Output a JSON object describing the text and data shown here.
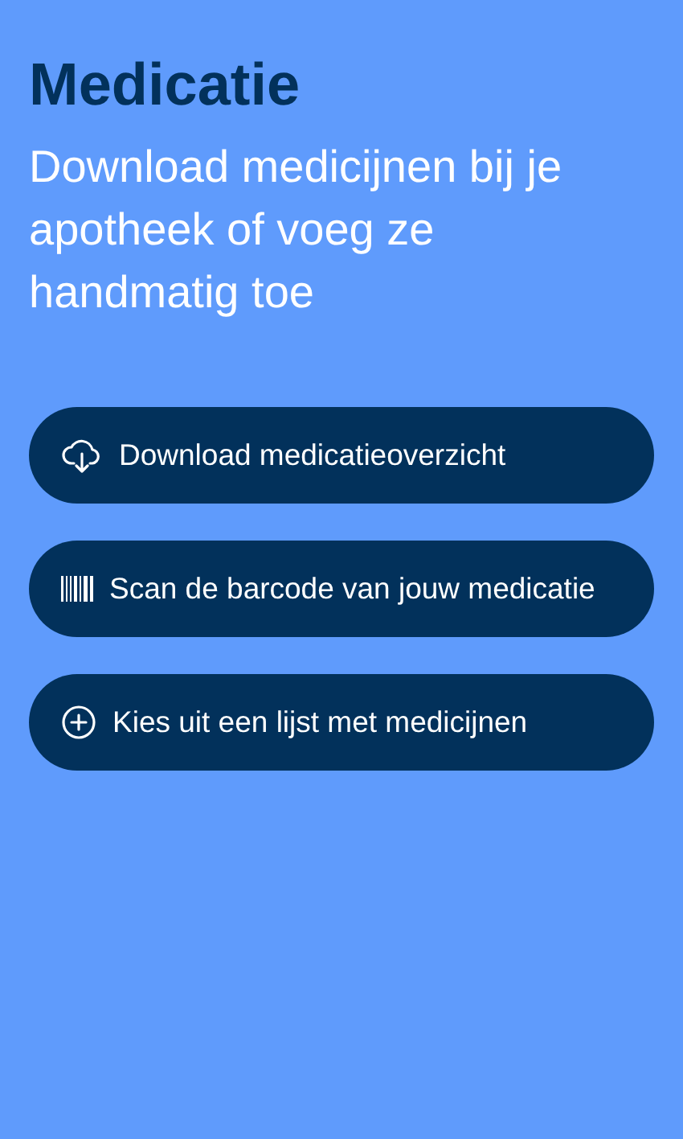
{
  "title": "Medicatie",
  "subtitle": "Download medicijnen bij je apotheek of voeg ze handmatig toe",
  "actions": [
    {
      "kind": "download",
      "label": "Download medicatieoverzicht"
    },
    {
      "kind": "barcode",
      "label": "Scan de barcode van jouw medicatie"
    },
    {
      "kind": "add",
      "label": "Kies uit een lijst met medicijnen"
    }
  ]
}
